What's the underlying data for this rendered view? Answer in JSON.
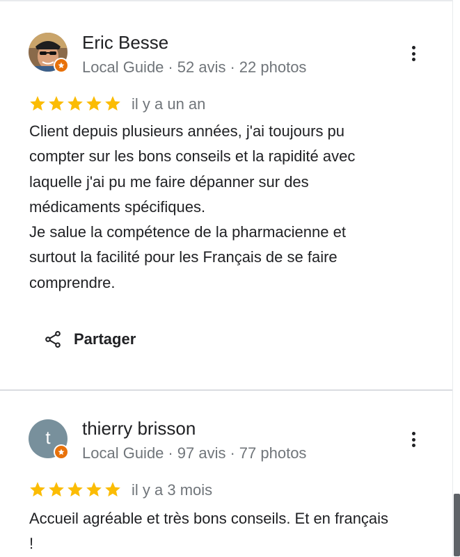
{
  "reviews": [
    {
      "author": "Eric Besse",
      "badge": "Local Guide",
      "reviews_count": "52 avis",
      "photos_count": "22 photos",
      "rating": 5,
      "time": "il y a un an",
      "text": "Client depuis plusieurs années, j'ai toujours pu\ncompter sur les bons conseils et la rapidité avec\nlaquelle j'ai pu me faire dépanner sur des\nmédicaments spécifiques.\nJe salue la compétence de la pharmacienne et\nsurtout la facilité pour les Français de se faire\ncomprendre.",
      "share_label": "Partager"
    },
    {
      "author": "thierry brisson",
      "avatar_letter": "t",
      "badge": "Local Guide",
      "reviews_count": "97 avis",
      "photos_count": "77 photos",
      "rating": 5,
      "time": "il y a 3 mois",
      "text": "Accueil agréable et très bons conseils. Et en français\n!"
    }
  ],
  "colors": {
    "star": "#fbbc04",
    "badge": "#e8710a",
    "secondary_text": "#70757a",
    "avatar_bg": "#78909c"
  }
}
